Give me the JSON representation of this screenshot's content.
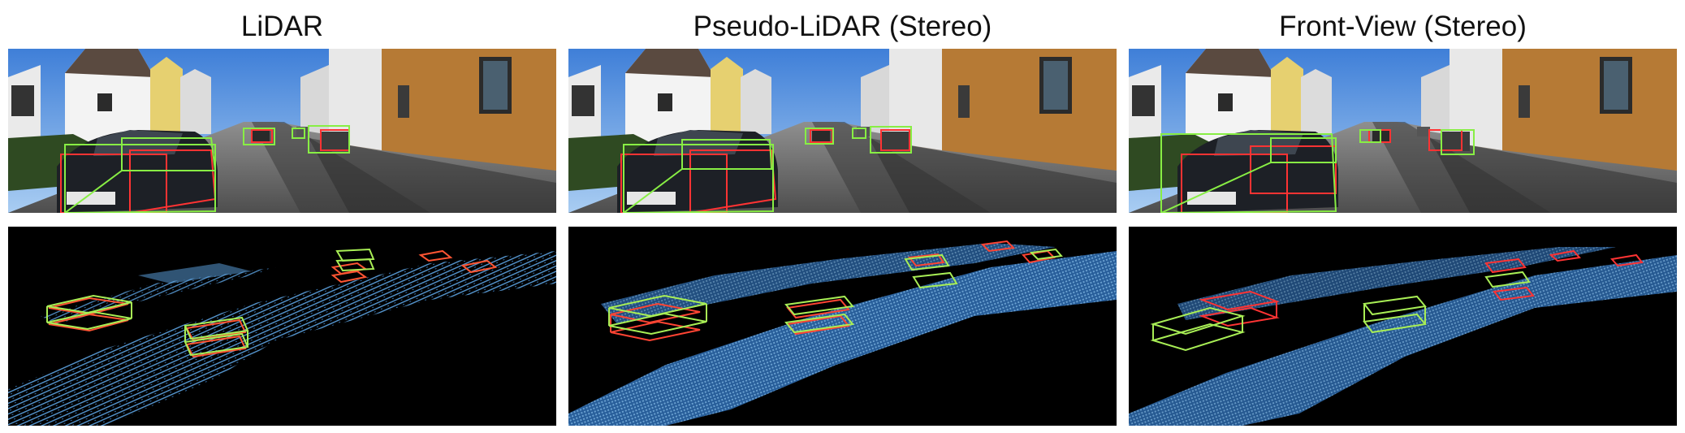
{
  "figure": {
    "panels": [
      {
        "title": "LiDAR"
      },
      {
        "title": "Pseudo-LiDAR (Stereo)"
      },
      {
        "title": "Front-View (Stereo)"
      }
    ]
  },
  "colors": {
    "ground_truth_box": "#ff3333",
    "predicted_box": "#88ee44",
    "point_cloud": "#5fa8e8",
    "background": "#000000"
  }
}
